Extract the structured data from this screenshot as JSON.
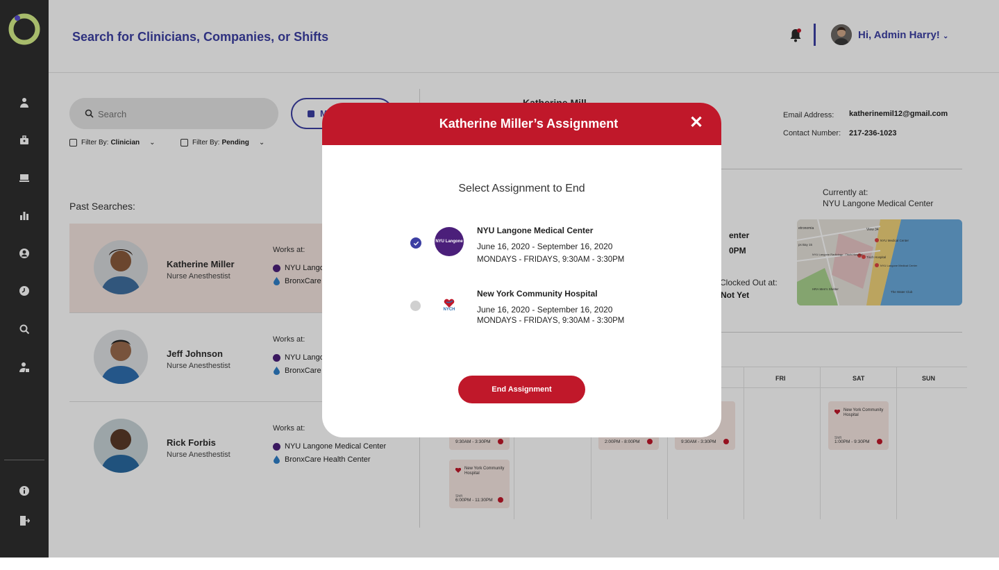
{
  "header": {
    "title": "Search for Clinicians, Companies, or Shifts",
    "greeting": "Hi, Admin Harry!"
  },
  "sidebar": {
    "icons": [
      "clinician-icon",
      "briefcase-icon",
      "monitor-icon",
      "bar-chart-icon",
      "user-circle-icon",
      "clock-icon",
      "search-icon",
      "user-tag-icon"
    ],
    "bottom_icons": [
      "info-icon",
      "logout-icon"
    ]
  },
  "search": {
    "placeholder": "Search",
    "filters": [
      {
        "label": "Filter By:",
        "value": "Clinician"
      },
      {
        "label": "Filter By:",
        "value": "Pending"
      }
    ],
    "button_partial": "M"
  },
  "past_searches": {
    "label": "Past Searches:",
    "items": [
      {
        "name": "Katherine Miller",
        "role": "Nurse Anesthestist",
        "works_at_label": "Works at:",
        "places": [
          "NYU Lango",
          "BronxCare"
        ]
      },
      {
        "name": "Jeff Johnson",
        "role": "Nurse Anesthestist",
        "works_at_label": "Works at:",
        "places": [
          "NYU Lango",
          "BronxCare"
        ]
      },
      {
        "name": "Rick Forbis",
        "role": "Nurse Anesthestist",
        "works_at_label": "Works at:",
        "places": [
          "NYU Langone Medical Center",
          "BronxCare Health Center"
        ]
      }
    ]
  },
  "details": {
    "name_partial": "Katherine Mill",
    "email_label": "Email Address:",
    "email": "katherinemil12@gmail.com",
    "contact_label": "Contact Number:",
    "contact": "217-236-1023",
    "currently_at_label": "Currently at:",
    "currently_at": "NYU Langone Medical Center",
    "partial_center": "enter",
    "partial_pm": "0PM",
    "clocked_out_label": "Clocked Out at:",
    "clocked_out_value": "Not Yet",
    "map": {
      "labels": [
        "etronomia",
        "View 34",
        "NYU Medical Center",
        "ps Bay 15",
        "NYU Langone Radiology - Tisch Hospital",
        "Tisch Hospital",
        "NYU Langone Medical Center",
        "HRA Men's Shelter",
        "The Water Club"
      ]
    }
  },
  "calendar": {
    "days": [
      "FRI",
      "SAT",
      "SUN"
    ],
    "cards": [
      {
        "time": "9:30AM - 3:30PM"
      },
      {
        "name": "New York Community Hospital",
        "shift_label": "Shift",
        "time": "6:00PM - 11:30PM"
      },
      {
        "time": "2:00PM - 8:00PM"
      },
      {
        "time": "9:30AM - 3:30PM"
      },
      {
        "name": "New York Community Hospital",
        "shift_label": "Shift",
        "time": "1:00PM - 9:30PM"
      }
    ]
  },
  "modal": {
    "title": "Katherine Miller’s Assignment",
    "subtitle": "Select Assignment to End",
    "assignments": [
      {
        "hospital": "NYU Langone Medical Center",
        "logo_text": "NYU Langone",
        "dates": "June 16, 2020 - September 16, 2020",
        "schedule": "MONDAYS - FRIDAYS, 9:30AM - 3:30PM",
        "selected": true
      },
      {
        "hospital": "New York Community Hospital",
        "logo_text": "NYCH",
        "dates": "June 16, 2020 - September 16, 2020",
        "schedule": "MONDAYS - FRIDAYS, 9:30AM - 3:30PM",
        "selected": false
      }
    ],
    "end_button": "End Assignment"
  },
  "colors": {
    "brand_red": "#c0182a",
    "brand_purple": "#3c3fa3",
    "sidebar": "#2f2f2f",
    "logo_green": "#d7f08a"
  }
}
